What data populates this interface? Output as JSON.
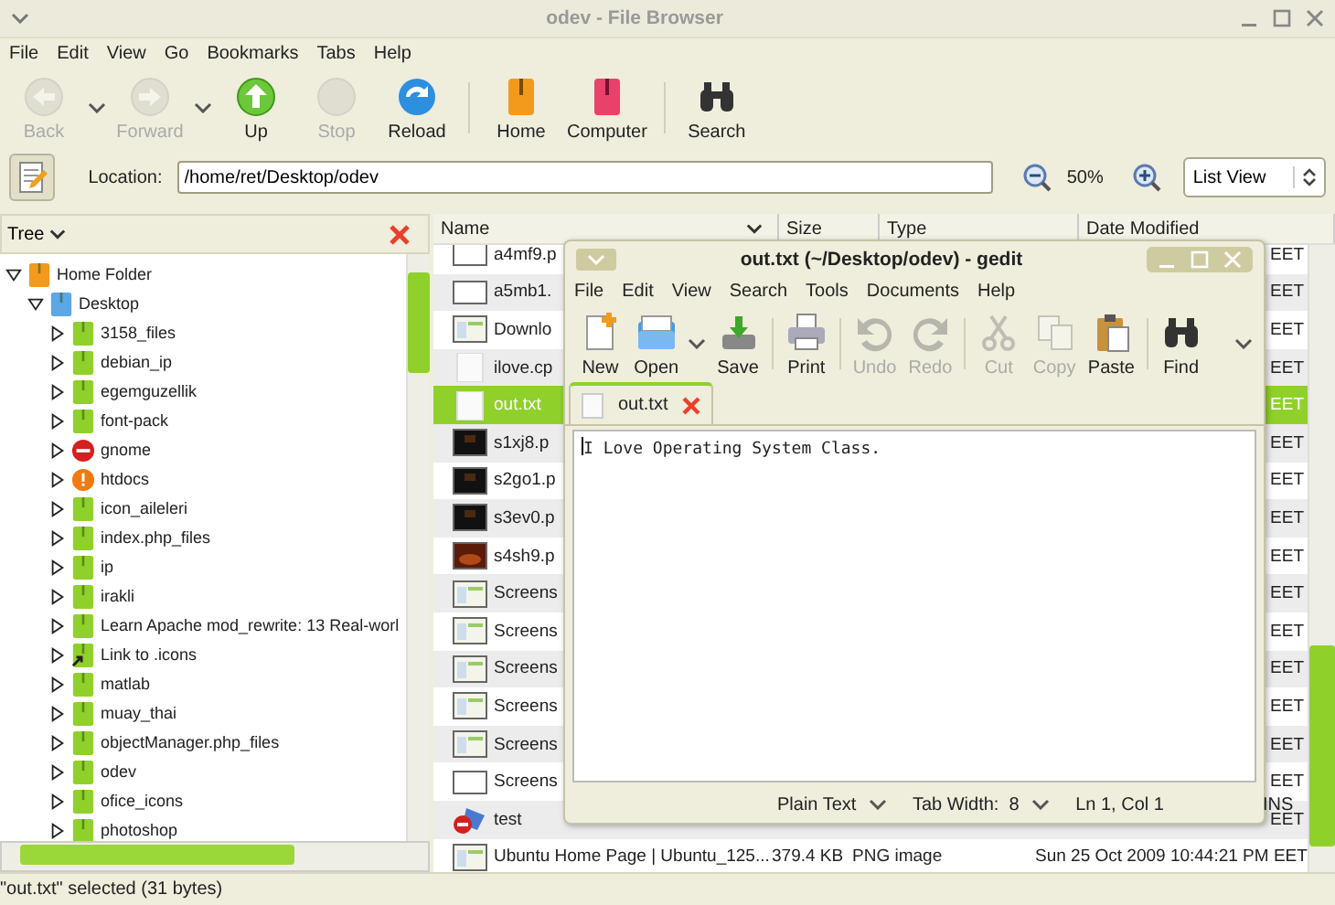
{
  "window": {
    "title": "odev - File Browser"
  },
  "menu": [
    "File",
    "Edit",
    "View",
    "Go",
    "Bookmarks",
    "Tabs",
    "Help"
  ],
  "toolbar": [
    {
      "label": "Back",
      "kind": "back",
      "disabled": true,
      "dropdown": true
    },
    {
      "label": "Forward",
      "kind": "forward",
      "disabled": true,
      "dropdown": true
    },
    {
      "label": "Up",
      "kind": "up",
      "disabled": false,
      "dropdown": false
    },
    {
      "label": "Stop",
      "kind": "stop",
      "disabled": true,
      "dropdown": false
    },
    {
      "label": "Reload",
      "kind": "reload",
      "disabled": false,
      "dropdown": false
    },
    {
      "label": "Home",
      "kind": "home",
      "disabled": false,
      "dropdown": false
    },
    {
      "label": "Computer",
      "kind": "computer",
      "disabled": false,
      "dropdown": false
    },
    {
      "label": "Search",
      "kind": "search",
      "disabled": false,
      "dropdown": false
    }
  ],
  "location": {
    "label": "Location:",
    "value": "/home/ret/Desktop/odev",
    "zoom": "50%",
    "view": "List View"
  },
  "sidebar": {
    "title": "Tree",
    "tree": [
      {
        "label": "Home Folder",
        "kind": "home",
        "expanded": true,
        "children": [
          {
            "label": "Desktop",
            "kind": "desktop",
            "expanded": true,
            "children": [
              {
                "label": "3158_files",
                "kind": "folder",
                "expanded": false
              },
              {
                "label": "debian_ip",
                "kind": "folder",
                "expanded": false
              },
              {
                "label": "egemguzellik",
                "kind": "folder",
                "expanded": false
              },
              {
                "label": "font-pack",
                "kind": "folder",
                "expanded": false
              },
              {
                "label": "gnome",
                "kind": "blocked",
                "expanded": false
              },
              {
                "label": "htdocs",
                "kind": "warning",
                "expanded": false
              },
              {
                "label": "icon_aileleri",
                "kind": "folder",
                "expanded": false
              },
              {
                "label": "index.php_files",
                "kind": "folder",
                "expanded": false
              },
              {
                "label": "ip",
                "kind": "folder",
                "expanded": false
              },
              {
                "label": "irakli",
                "kind": "folder",
                "expanded": false
              },
              {
                "label": "Learn Apache mod_rewrite: 13 Real-worl",
                "kind": "folder",
                "expanded": false
              },
              {
                "label": "Link to .icons",
                "kind": "link",
                "expanded": false
              },
              {
                "label": "matlab",
                "kind": "folder",
                "expanded": false
              },
              {
                "label": "muay_thai",
                "kind": "folder",
                "expanded": false
              },
              {
                "label": "objectManager.php_files",
                "kind": "folder",
                "expanded": false
              },
              {
                "label": "odev",
                "kind": "folder",
                "expanded": false
              },
              {
                "label": "ofice_icons",
                "kind": "folder",
                "expanded": false
              },
              {
                "label": "photoshop",
                "kind": "folder",
                "expanded": false
              }
            ]
          }
        ]
      }
    ]
  },
  "files": {
    "columns": [
      "Name",
      "Size",
      "Type",
      "Date Modified"
    ],
    "rows": [
      {
        "name": "a4mf9.p",
        "kind": "frame",
        "date": "EET",
        "selected": false
      },
      {
        "name": "a5mb1.",
        "kind": "frame",
        "date": "EET",
        "selected": false
      },
      {
        "name": "Downlo",
        "kind": "screenshot",
        "date": "EET",
        "selected": false
      },
      {
        "name": "ilove.cp",
        "kind": "blank",
        "date": "EET",
        "selected": false
      },
      {
        "name": "out.txt",
        "kind": "blank",
        "date": "EET",
        "selected": true
      },
      {
        "name": "s1xj8.p",
        "kind": "dark",
        "date": "EET",
        "selected": false
      },
      {
        "name": "s2go1.p",
        "kind": "dark",
        "date": "EET",
        "selected": false
      },
      {
        "name": "s3ev0.p",
        "kind": "dark",
        "date": "EET",
        "selected": false
      },
      {
        "name": "s4sh9.p",
        "kind": "brown",
        "date": "EET",
        "selected": false
      },
      {
        "name": "Screens",
        "kind": "screenshot",
        "date": "EET",
        "selected": false
      },
      {
        "name": "Screens",
        "kind": "screenshot",
        "date": "EET",
        "selected": false
      },
      {
        "name": "Screens",
        "kind": "screenshot",
        "date": "EET",
        "selected": false
      },
      {
        "name": "Screens",
        "kind": "screenshot",
        "date": "EET",
        "selected": false
      },
      {
        "name": "Screens",
        "kind": "screenshot",
        "date": "EET",
        "selected": false
      },
      {
        "name": "Screens",
        "kind": "frame",
        "date": "EET",
        "selected": false
      },
      {
        "name": "test",
        "kind": "blocked",
        "date": "EET",
        "selected": false
      },
      {
        "name": "Ubuntu Home Page | Ubuntu_125...",
        "kind": "screenshot",
        "size": "379.4 KB",
        "type": "PNG image",
        "date": "Sun 25 Oct 2009 10:44:21 PM EET",
        "selected": false
      }
    ]
  },
  "gedit": {
    "title": "out.txt (~/Desktop/odev) - gedit",
    "menu": [
      "File",
      "Edit",
      "View",
      "Search",
      "Tools",
      "Documents",
      "Help"
    ],
    "toolbar": [
      {
        "label": "New",
        "kind": "new",
        "disabled": false,
        "dropdown": false
      },
      {
        "label": "Open",
        "kind": "open",
        "disabled": false,
        "dropdown": true
      },
      {
        "label": "Save",
        "kind": "save",
        "disabled": false,
        "dropdown": false
      },
      {
        "label": "Print",
        "kind": "print",
        "disabled": false,
        "dropdown": false
      },
      {
        "label": "Undo",
        "kind": "undo",
        "disabled": true,
        "dropdown": false
      },
      {
        "label": "Redo",
        "kind": "redo",
        "disabled": true,
        "dropdown": false
      },
      {
        "label": "Cut",
        "kind": "cut",
        "disabled": true,
        "dropdown": false
      },
      {
        "label": "Copy",
        "kind": "copy",
        "disabled": true,
        "dropdown": false
      },
      {
        "label": "Paste",
        "kind": "paste",
        "disabled": false,
        "dropdown": false
      },
      {
        "label": "Find",
        "kind": "find",
        "disabled": false,
        "dropdown": false
      }
    ],
    "tabs": [
      {
        "label": "out.txt",
        "selected": true
      }
    ],
    "text": "I Love Operating System Class.",
    "status": {
      "language": "Plain Text",
      "tab_width": "Tab Width:  8",
      "position": "Ln 1, Col 1",
      "mode": "INS"
    }
  },
  "status_bar": "\"out.txt\" selected (31 bytes)"
}
